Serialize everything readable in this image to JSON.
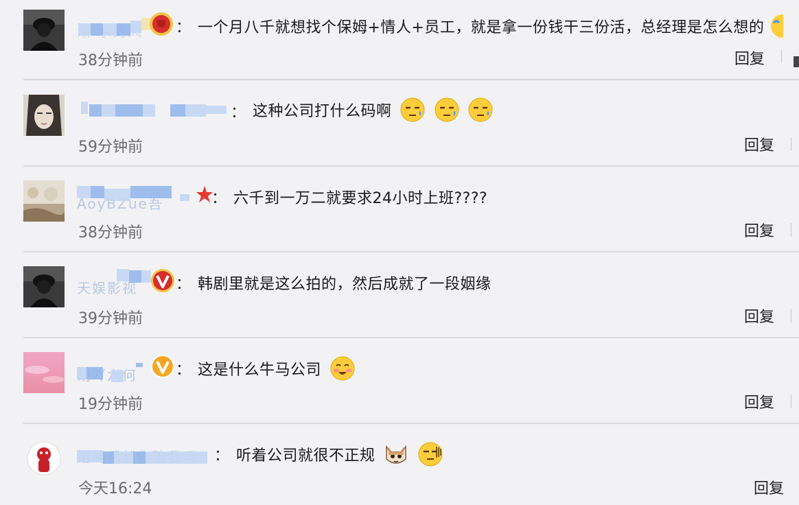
{
  "comments": [
    {
      "name": "渐  水的风",
      "badge": "red-shield-badge",
      "text": "一个月八千就想找个保姆+情人+员工，就是拿一份钱干三份活，总经理是怎么想的",
      "time": "38分钟前",
      "reply": "回复"
    },
    {
      "name": "：",
      "badge": "",
      "text": "这种公司打什么码啊",
      "time": "59分钟前",
      "reply": "回复"
    },
    {
      "name": "AoyBZue吾",
      "badge": "red-star-badge",
      "text": "六千到一万二就要求24小时上班????",
      "time": "38分钟前",
      "reply": "回复"
    },
    {
      "name": "天娱影视",
      "badge": "red-v-badge",
      "text": "韩剧里就是这么拍的，然后成就了一段姻缘",
      "time": "39分钟前",
      "reply": "回复"
    },
    {
      "name": "胡吖六何",
      "badge": "orange-v-badge",
      "text": "这是什么牛马公司",
      "time": "19分钟前",
      "reply": "回复"
    },
    {
      "name": "用纯后就你陪我吧",
      "badge": "",
      "text": "听着公司就很不正规",
      "time": "今天16:24",
      "reply": "回复"
    }
  ],
  "colon": "：",
  "colors": {
    "background": "#f2f2f5",
    "divider": "#dadade",
    "name_blur": "#8fb4ea",
    "time_text": "#6b6b6b",
    "badge_red": "#d62d2d",
    "badge_orange": "#f5a623",
    "emoji_yellow": "#ffcd3c"
  }
}
